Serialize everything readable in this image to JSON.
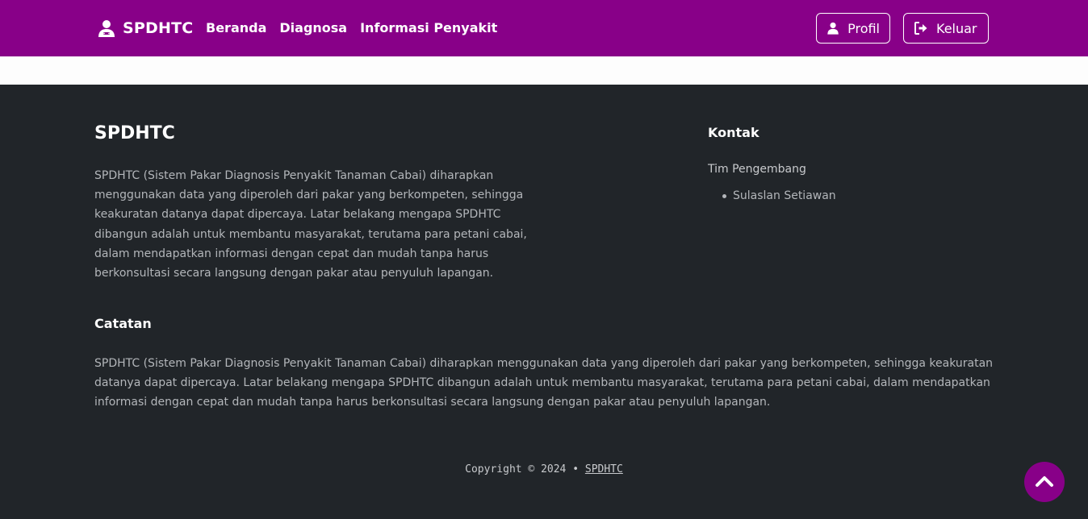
{
  "navbar": {
    "brand": "SPDHTC",
    "links": [
      "Beranda",
      "Diagnosa",
      "Informasi Penyakit"
    ],
    "profil_label": "Profil",
    "keluar_label": "Keluar",
    "brand_icon": "user-doctor-icon",
    "profil_icon": "user-icon",
    "keluar_icon": "sign-out-icon"
  },
  "footer": {
    "brand": "SPDHTC",
    "about": "SPDHTC (Sistem Pakar Diagnosis Penyakit Tanaman Cabai) diharapkan menggunakan data yang diperoleh dari pakar yang berkompeten, sehingga keakuratan datanya dapat dipercaya. Latar belakang mengapa SPDHTC dibangun adalah untuk membantu masyarakat, terutama para petani cabai, dalam mendapatkan informasi dengan cepat dan mudah tanpa harus berkonsultasi secara langsung dengan pakar atau penyuluh lapangan.",
    "kontak": {
      "title": "Kontak",
      "team_title": "Tim Pengembang",
      "members": [
        "Sulaslan Setiawan"
      ]
    },
    "catatan": {
      "title": "Catatan",
      "text": "SPDHTC (Sistem Pakar Diagnosis Penyakit Tanaman Cabai) diharapkan menggunakan data yang diperoleh dari pakar yang berkompeten, sehingga keakuratan datanya dapat dipercaya. Latar belakang mengapa SPDHTC dibangun adalah untuk membantu masyarakat, terutama para petani cabai, dalam mendapatkan informasi dengan cepat dan mudah tanpa harus berkonsultasi secara langsung dengan pakar atau penyuluh lapangan."
    },
    "copyright_prefix": "Copyright © 2024 • ",
    "copyright_link": "SPDHTC"
  },
  "back_to_top_icon": "chevron-up-icon",
  "colors": {
    "primary": "#880088",
    "footer_bg": "#212529",
    "strip_bg": "#fdfdfd"
  }
}
